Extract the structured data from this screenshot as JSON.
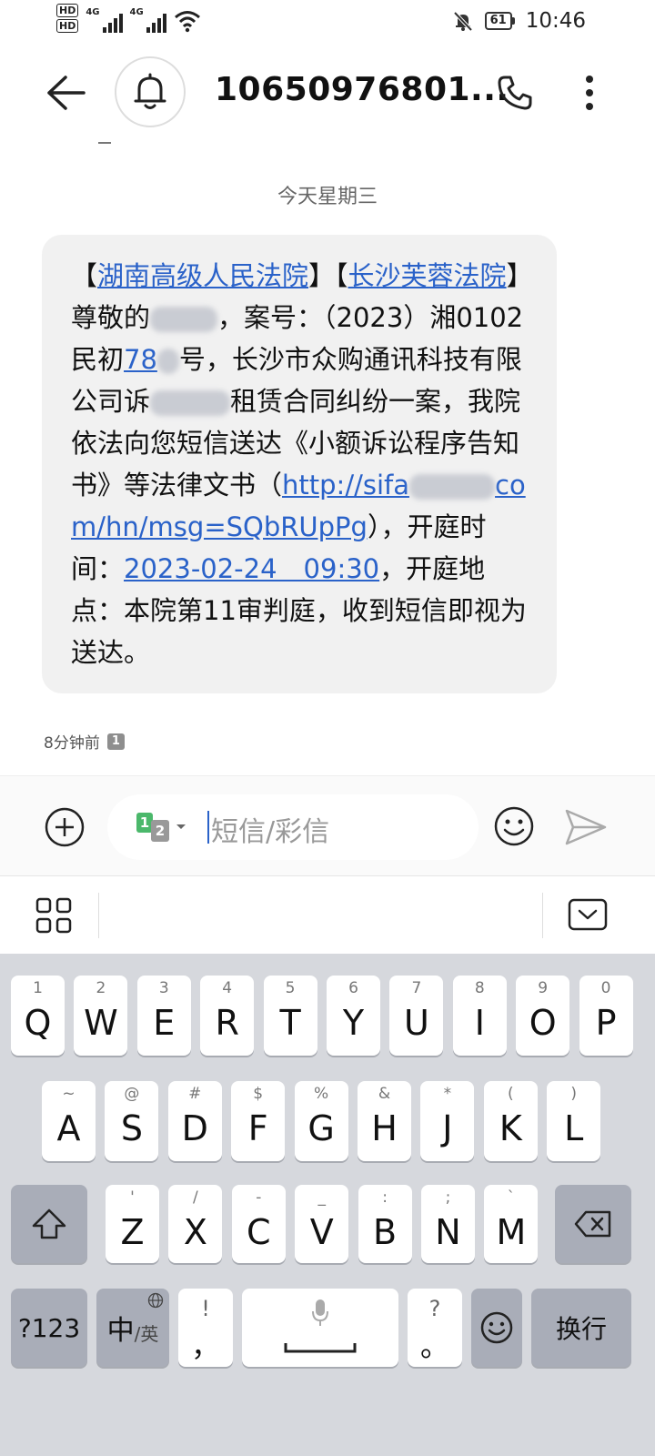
{
  "status_bar": {
    "hd1": "HD",
    "hd2": "HD",
    "net1": "4G",
    "net2": "4G",
    "battery": "61",
    "time": "10:46"
  },
  "header": {
    "title": "10650976801..."
  },
  "conversation": {
    "date_label": "今天星期三",
    "message": {
      "seg1": "【",
      "link1": "湖南高级人民法院",
      "seg2": "】【",
      "link2": "长沙芙蓉法院",
      "seg3": "】尊敬的",
      "seg4": "，案号：（2023）湘0102民初",
      "link3": "78",
      "seg5": "号，长沙市众购通讯科技有限公司诉",
      "seg6": "租赁合同纠纷一案，我院依法向您短信送达《小额诉讼程序告知书》等法律文书（",
      "link4a": "http://sifa",
      "link4b": "com/",
      "link4c": "hn/msg=SQbRUpPg",
      "seg7": "），开庭时间：",
      "link5": "2023-02-24　09:30",
      "seg8": "，开庭地点：本院第11审判庭，收到短信即视为送达。"
    },
    "time_ago": "8分钟前",
    "sim_badge": "1"
  },
  "input": {
    "sim1": "1",
    "sim2": "2",
    "placeholder": "短信/彩信"
  },
  "keyboard": {
    "row1": [
      {
        "hint": "1",
        "key": "Q"
      },
      {
        "hint": "2",
        "key": "W"
      },
      {
        "hint": "3",
        "key": "E"
      },
      {
        "hint": "4",
        "key": "R"
      },
      {
        "hint": "5",
        "key": "T"
      },
      {
        "hint": "6",
        "key": "Y"
      },
      {
        "hint": "7",
        "key": "U"
      },
      {
        "hint": "8",
        "key": "I"
      },
      {
        "hint": "9",
        "key": "O"
      },
      {
        "hint": "0",
        "key": "P"
      }
    ],
    "row2": [
      {
        "hint": "~",
        "key": "A"
      },
      {
        "hint": "@",
        "key": "S"
      },
      {
        "hint": "#",
        "key": "D"
      },
      {
        "hint": "$",
        "key": "F"
      },
      {
        "hint": "%",
        "key": "G"
      },
      {
        "hint": "&",
        "key": "H"
      },
      {
        "hint": "*",
        "key": "J"
      },
      {
        "hint": "(",
        "key": "K"
      },
      {
        "hint": ")",
        "key": "L"
      }
    ],
    "row3": [
      {
        "hint": "'",
        "key": "Z"
      },
      {
        "hint": "/",
        "key": "X"
      },
      {
        "hint": "-",
        "key": "C"
      },
      {
        "hint": "_",
        "key": "V"
      },
      {
        "hint": ":",
        "key": "B"
      },
      {
        "hint": ";",
        "key": "N"
      },
      {
        "hint": "`",
        "key": "M"
      }
    ],
    "num_key": "?123",
    "lang_main": "中",
    "lang_sub": "/英",
    "comma_hint": "!",
    "comma_key": "，",
    "period_hint": "?",
    "period_key": "。",
    "enter_key": "换行"
  }
}
